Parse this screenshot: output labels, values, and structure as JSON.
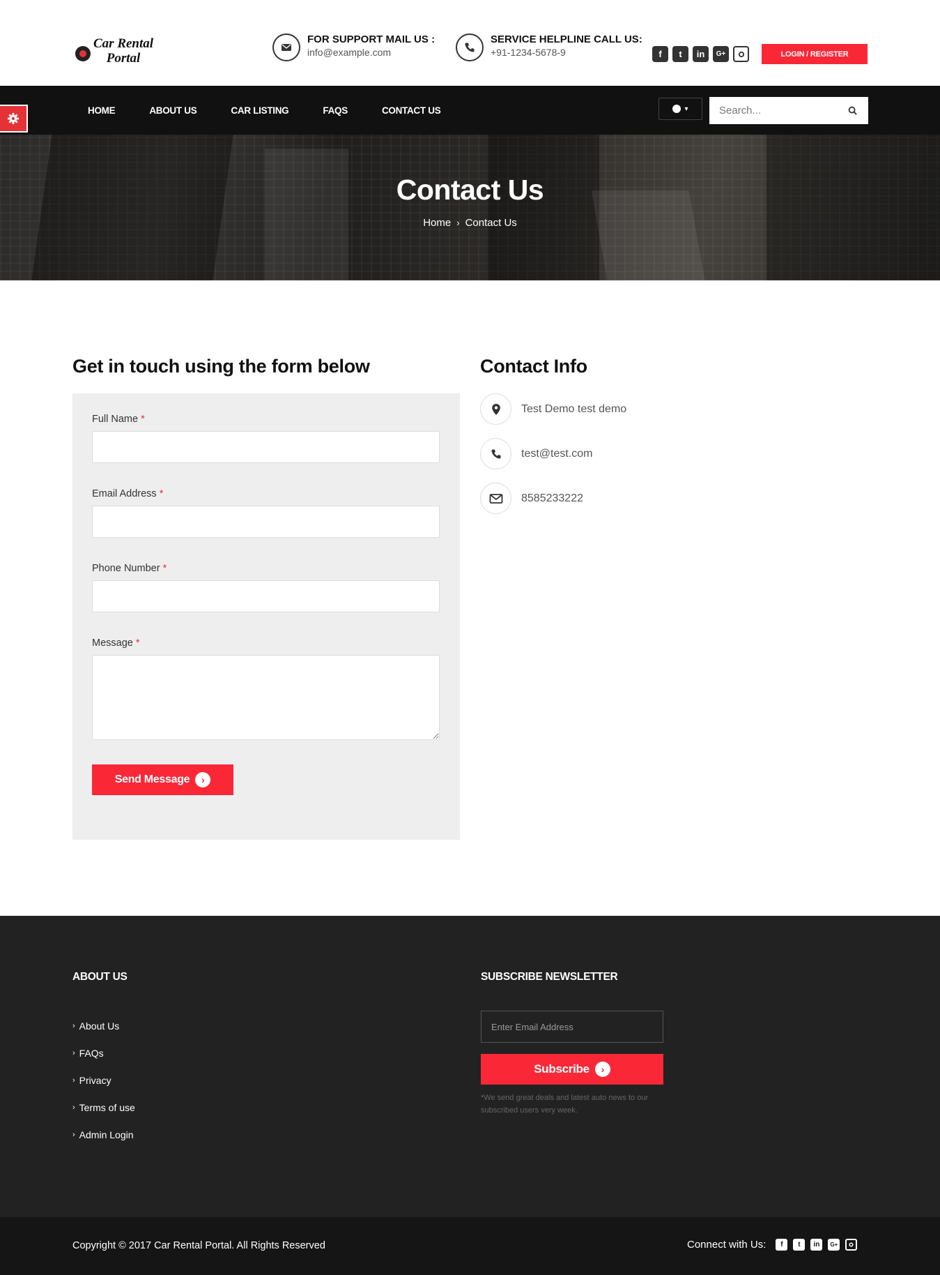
{
  "stray_char": "<",
  "brand": {
    "line1": "Car Rental",
    "line2": "Portal"
  },
  "support_mail": {
    "label": "FOR SUPPORT MAIL US :",
    "value": "info@example.com"
  },
  "support_call": {
    "label": "SERVICE HELPLINE CALL US:",
    "value": "+91-1234-5678-9"
  },
  "social_icons": [
    "facebook-icon",
    "twitter-icon",
    "linkedin-icon",
    "google-plus-icon",
    "instagram-icon"
  ],
  "login_label": "LOGIN / REGISTER",
  "nav": {
    "items": [
      "HOME",
      "ABOUT US",
      "CAR LISTING",
      "FAQS",
      "CONTACT US"
    ],
    "search_placeholder": "Search..."
  },
  "banner": {
    "title": "Contact Us",
    "crumb_home": "Home",
    "crumb_current": "Contact Us"
  },
  "form": {
    "heading": "Get in touch using the form below",
    "full_name_label": "Full Name",
    "email_label": "Email Address",
    "phone_label": "Phone Number",
    "message_label": "Message",
    "required_mark": "*",
    "send_label": "Send Message"
  },
  "contact_info": {
    "heading": "Contact Info",
    "address": "Test Demo test demo",
    "email": "test@test.com",
    "phone": "8585233222"
  },
  "footer": {
    "about_heading": "ABOUT US",
    "links": [
      "About Us",
      "FAQs",
      "Privacy",
      "Terms of use",
      "Admin Login"
    ],
    "newsletter_heading": "SUBSCRIBE NEWSLETTER",
    "email_placeholder": "Enter Email Address",
    "subscribe_label": "Subscribe",
    "note": "*We send great deals and latest auto news to our subscribed users very week.",
    "copyright": "Copyright © 2017 Car Rental Portal. All Rights Reserved",
    "connect_label": "Connect with Us:"
  },
  "colors": {
    "accent": "#fa2837",
    "nav_bg": "#111111",
    "footer_bg": "#222222",
    "bottom_bg": "#151515"
  }
}
